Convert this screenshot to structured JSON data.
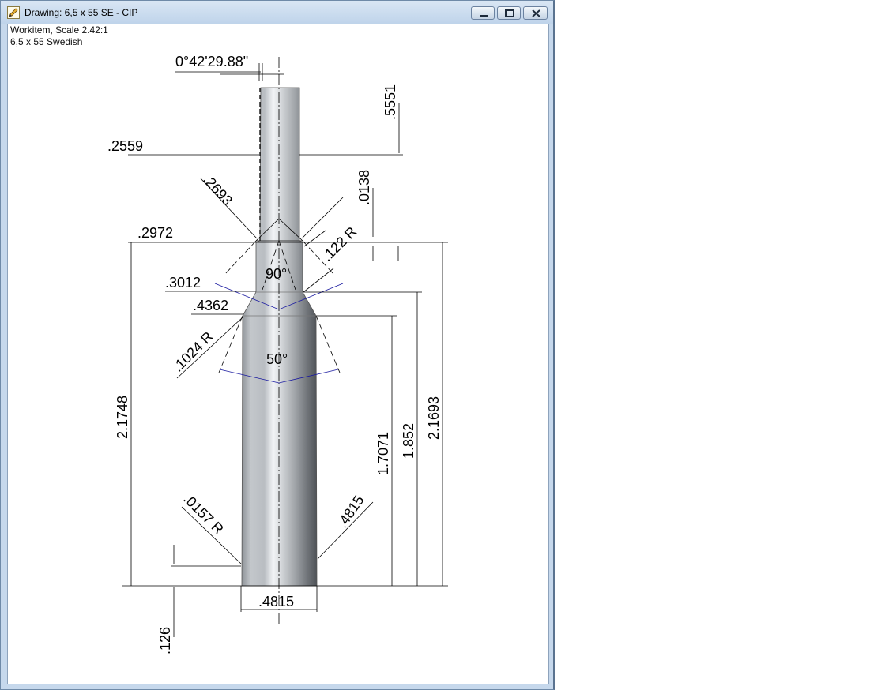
{
  "window": {
    "title": "Drawing: 6,5 x 55 SE - CIP",
    "icon": "pencil-drawing-icon",
    "controls": {
      "minimize_icon": "minimize-icon",
      "maximize_icon": "maximize-icon",
      "close_icon": "close-icon"
    }
  },
  "drawing": {
    "workitem_line": "Workitem, Scale 2.42:1",
    "cartridge_line": "6,5 x 55 Swedish"
  },
  "dimensions": {
    "taper_angle": "0°42'29.88\"",
    "neck_length": ".5551",
    "mouth_diameter": ".2559",
    "chamfer_diameter": ".2693",
    "lip_depth": ".0138",
    "neck_base_diameter": ".2972",
    "neck_radius": ".122 R",
    "shoulder_angle_label": "90°",
    "neck_shoulder_diameter": ".3012",
    "shoulder_diameter": ".4362",
    "shoulder_radius": ".1024 R",
    "body_angle_label": "50°",
    "case_length": "2.1748",
    "body_length_a": "1.7071",
    "body_length_b": "1.852",
    "body_length_c": "2.1693",
    "rim_radius": ".0157 R",
    "base_diameter_diag": ".4815",
    "base_diameter": ".4815",
    "rim_height": ".126"
  },
  "colors": {
    "titlebar": "#c6d8ec",
    "dimension_line": "#000000",
    "angle_line": "#1a1aa0",
    "metal_dark": "#4f5358",
    "metal_light": "#f2f4f6"
  }
}
